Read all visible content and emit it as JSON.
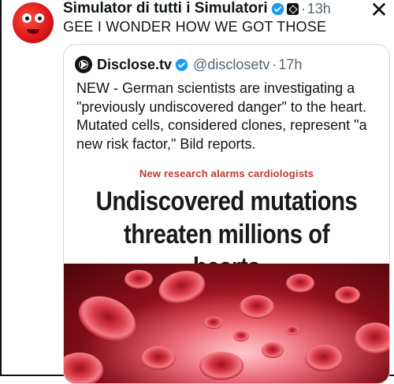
{
  "tweet": {
    "author_name": "Simulator di tutti i Simulatori",
    "separator": "·",
    "time": "13h",
    "text": "GEE I WONDER HOW WE GOT THOSE"
  },
  "quote": {
    "name": "Disclose.tv",
    "handle": "@disclosetv",
    "separator": "·",
    "time": "17h",
    "text": "NEW - German scientists are investigating a \"previously undiscovered danger\" to the heart. Mutated cells, considered clones, represent \"a new risk factor,\" Bild reports."
  },
  "article": {
    "kicker": "New research alarms cardiologists",
    "headline_line1": "Undiscovered mutations",
    "headline_line2": "threaten millions of hearts"
  },
  "colors": {
    "verified": "#1d9bf0",
    "kicker": "#c0392b",
    "muted": "#536471"
  },
  "icons": {
    "close": "close-icon",
    "verified": "verified-badge-icon"
  }
}
